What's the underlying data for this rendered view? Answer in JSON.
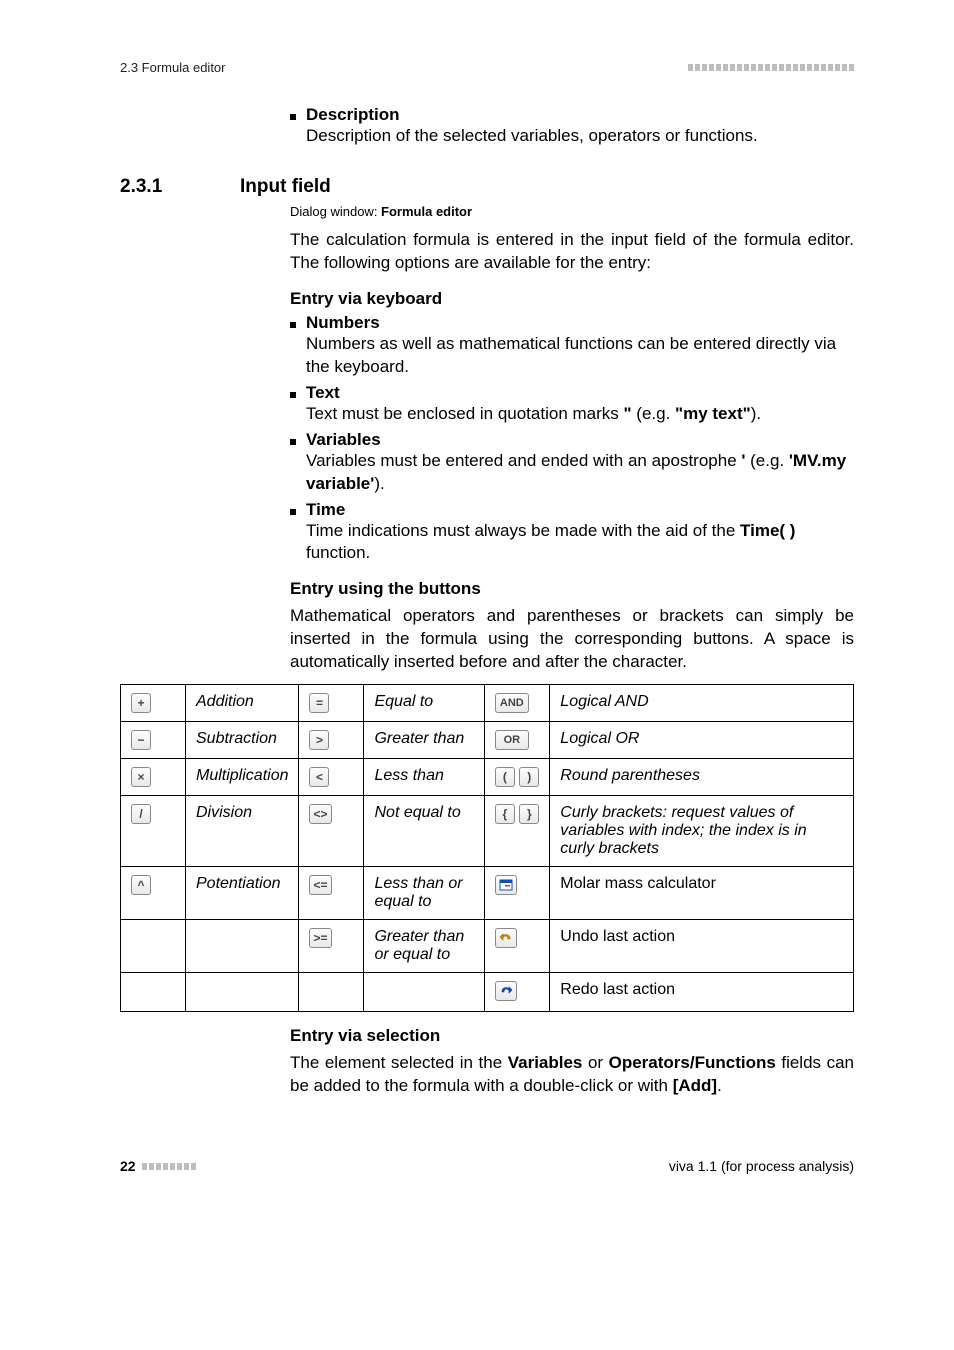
{
  "header": {
    "left": "2.3 Formula editor"
  },
  "topBullets": [
    {
      "title": "Description",
      "body": "Description of the selected variables, operators or functions."
    }
  ],
  "section": {
    "number": "2.3.1",
    "title": "Input field",
    "dialogPrefix": "Dialog window: ",
    "dialogStrong": "Formula editor",
    "intro": "The calculation formula is entered in the input field of the formula editor. The following options are available for the entry:"
  },
  "entryKeyboard": {
    "heading": "Entry via keyboard",
    "items": [
      {
        "title": "Numbers",
        "body": "Numbers as well as mathematical functions can be entered directly via the keyboard."
      },
      {
        "title": "Text",
        "prefix": "Text must be enclosed in quotation marks ",
        "q1": "\"",
        "mid": " (e.g. ",
        "strong": "\"my text\"",
        "suffix": ")."
      },
      {
        "title": "Variables",
        "prefix": "Variables must be entered and ended with an apostrophe ",
        "q1": "'",
        "mid": " (e.g. ",
        "strong": "'MV.my variable'",
        "suffix": ")."
      },
      {
        "title": "Time",
        "prefix": "Time indications must always be made with the aid of the ",
        "strong": "Time( )",
        "suffix": " function."
      }
    ]
  },
  "entryButtons": {
    "heading": "Entry using the buttons",
    "para": "Mathematical operators and parentheses or brackets can simply be inserted in the formula using the corresponding buttons. A space is automatically inserted before and after the character."
  },
  "table": {
    "rows": [
      {
        "c1": "+",
        "d1": "Addition",
        "c2": "=",
        "d2": "Equal to",
        "c3": "AND",
        "d3": "Logical AND"
      },
      {
        "c1": "−",
        "d1": "Subtraction",
        "c2": ">",
        "d2": "Greater than",
        "c3": "OR",
        "d3": "Logical OR"
      },
      {
        "c1": "×",
        "d1": "Multiplication",
        "c2": "<",
        "d2": "Less than",
        "c3pair": [
          "(",
          ")"
        ],
        "d3": "Round parentheses"
      },
      {
        "c1": "/",
        "d1": "Division",
        "c2": "<>",
        "d2": "Not equal to",
        "c3pair": [
          "{",
          "}"
        ],
        "d3": "Curly brackets: request values of variables with index; the index is in curly brackets"
      },
      {
        "c1": "^",
        "d1": "Potentiation",
        "c2": "<=",
        "d2": "Less than or equal to",
        "c3svg": "molar",
        "d3": "Molar mass calculator"
      },
      {
        "c1": "",
        "d1": "",
        "c2": ">=",
        "d2": "Greater than or equal to",
        "c3svg": "undo",
        "d3": "Undo last action"
      },
      {
        "c1": "",
        "d1": "",
        "c2": "",
        "d2": "",
        "c3svg": "redo",
        "d3": "Redo last action"
      }
    ]
  },
  "entrySelection": {
    "heading": "Entry via selection",
    "prefix": "The element selected in the ",
    "s1": "Variables",
    "mid1": " or ",
    "s2": "Operators/Functions",
    "mid2": " fields can be added to the formula with a double-click or with ",
    "s3": "[Add]",
    "suffix": "."
  },
  "footer": {
    "page": "22",
    "right": "viva 1.1 (for process analysis)"
  }
}
